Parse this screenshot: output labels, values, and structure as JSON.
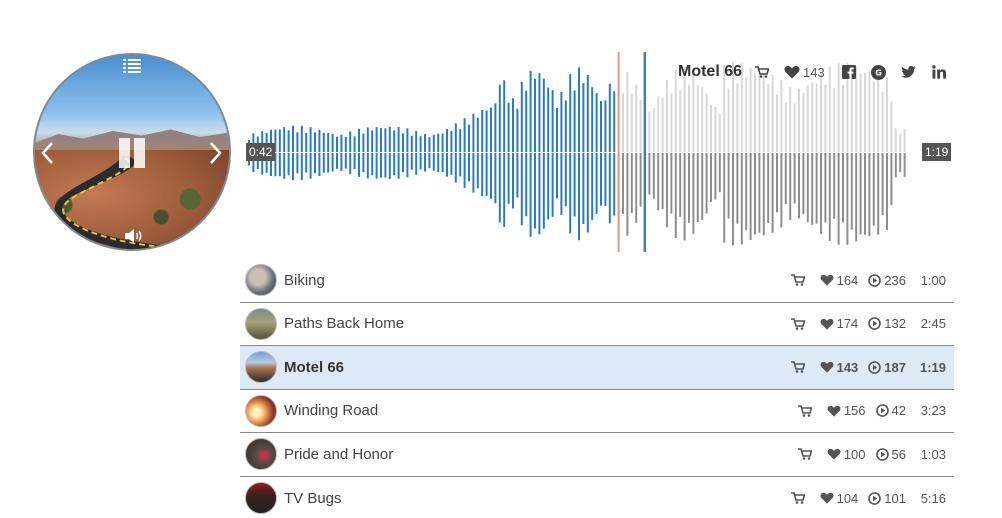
{
  "colors": {
    "played": "#2b7bbf",
    "played_light": "#8fc0e6",
    "unplayed": "#8e8e8e",
    "unplayed_light": "#d8d8d8",
    "playhead": "#e59a8f",
    "hover_line": "#3c7fb0",
    "active_row": "#dde9f7"
  },
  "player": {
    "current_time": "0:42",
    "duration": "1:19",
    "progress": 0.56,
    "cover_icons": {
      "list": "list-icon",
      "pause": "pause-icon",
      "prev": "chevron-left-icon",
      "next": "chevron-right-icon",
      "volume": "volume-icon"
    }
  },
  "now_playing": {
    "title": "Motel 66",
    "likes": "143",
    "icons": [
      "cart-icon",
      "heart-icon",
      "facebook-icon",
      "google-plus-icon",
      "twitter-icon",
      "linkedin-icon"
    ]
  },
  "playlist": [
    {
      "title": "Biking",
      "likes": "164",
      "plays": "236",
      "duration": "1:00",
      "active": false
    },
    {
      "title": "Paths Back Home",
      "likes": "174",
      "plays": "132",
      "duration": "2:45",
      "active": false
    },
    {
      "title": "Motel 66",
      "likes": "143",
      "plays": "187",
      "duration": "1:19",
      "active": true
    },
    {
      "title": "Winding Road",
      "likes": "156",
      "plays": "42",
      "duration": "3:23",
      "active": false
    },
    {
      "title": "Pride and Honor",
      "likes": "100",
      "plays": "56",
      "duration": "1:03",
      "active": false
    },
    {
      "title": "TV Bugs",
      "likes": "104",
      "plays": "101",
      "duration": "5:16",
      "active": false
    }
  ]
}
